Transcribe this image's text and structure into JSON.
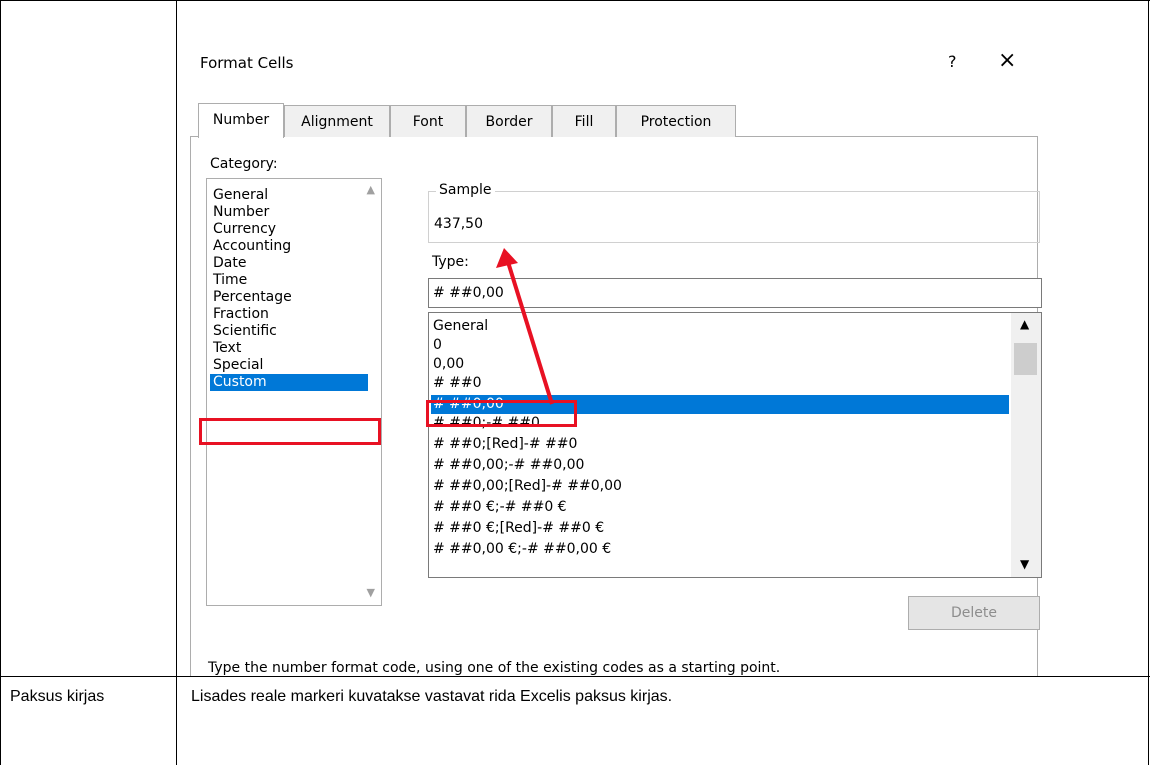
{
  "table": {
    "row_label": "Paksus kirjas",
    "row_text": "Lisades reale markeri kuvatakse vastavat rida Excelis paksus kirjas."
  },
  "dialog": {
    "title": "Format Cells",
    "help_label": "?",
    "close_label": "×",
    "tabs": [
      "Number",
      "Alignment",
      "Font",
      "Border",
      "Fill",
      "Protection"
    ],
    "active_tab": "Number",
    "category_label": "Category:",
    "categories": [
      "General",
      "Number",
      "Currency",
      "Accounting",
      "Date",
      "Time",
      "Percentage",
      "Fraction",
      "Scientific",
      "Text",
      "Special",
      "Custom"
    ],
    "selected_category": "Custom",
    "sample_label": "Sample",
    "sample_value": "437,50",
    "type_label": "Type:",
    "type_value": "# ##0,00",
    "formats": [
      "General",
      "0",
      "0,00",
      "# ##0",
      "# ##0,00",
      "# ##0;-# ##0",
      "# ##0;[Red]-# ##0",
      "# ##0,00;-# ##0,00",
      "# ##0,00;[Red]-# ##0,00",
      "# ##0 €;-# ##0 €",
      "# ##0 €;[Red]-# ##0 €",
      "# ##0,00 €;-# ##0,00 €"
    ],
    "selected_format": "# ##0,00",
    "delete_label": "Delete",
    "hint": "Type the number format code, using one of the existing codes as a starting point.",
    "icons": {
      "scroll_up": "chevron-up-icon",
      "scroll_down": "chevron-down-icon"
    }
  },
  "colors": {
    "selection": "#0078d7",
    "annotation": "#e81123"
  }
}
